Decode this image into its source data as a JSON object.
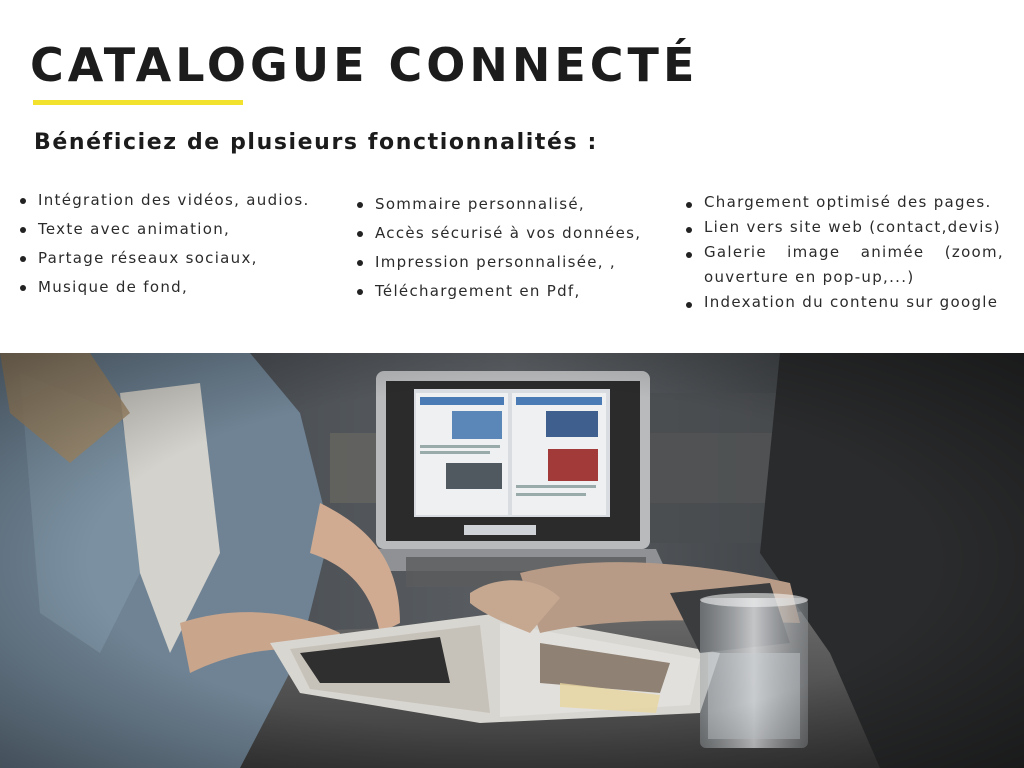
{
  "title": "CATALOGUE CONNECTÉ",
  "subtitle": "Bénéficiez de plusieurs fonctionnalités :",
  "accent_color": "#f2e12d",
  "features": {
    "col1": [
      "Intégration des vidéos, audios.",
      "Texte avec animation,",
      "Partage réseaux sociaux,",
      "Musique de fond,"
    ],
    "col2": [
      "Sommaire personnalisé,",
      "Accès sécurisé à vos données,",
      "Impression personnalisée, ,",
      "Téléchargement en Pdf,"
    ],
    "col3": [
      "Chargement optimisé des pages.",
      "Lien vers site web (contact,devis)",
      "Galerie image animée (zoom, ouverture en pop-up,...)",
      "Indexation du contenu sur google"
    ]
  },
  "photo": {
    "icon": "office-meeting-photo"
  }
}
